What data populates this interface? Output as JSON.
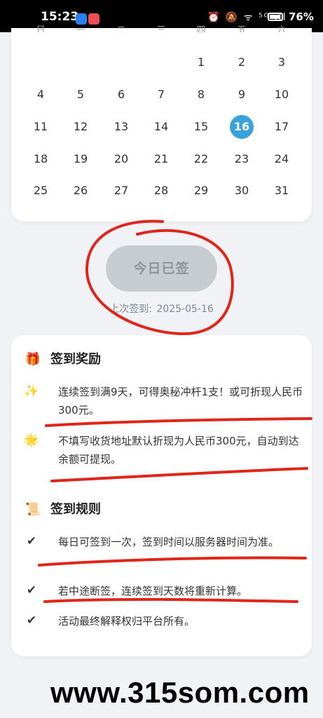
{
  "status_bar": {
    "time": "15:23",
    "icons": "⏰ 🔕 ᯤ ⁵ᴳ ıll",
    "battery": "76%"
  },
  "calendar": {
    "weekday_headers": [
      "日",
      "一",
      "二",
      "三",
      "四",
      "五",
      "六"
    ],
    "weeks": [
      [
        "",
        "",
        "",
        "",
        "1",
        "2",
        "3"
      ],
      [
        "4",
        "5",
        "6",
        "7",
        "8",
        "9",
        "10"
      ],
      [
        "11",
        "12",
        "13",
        "14",
        "15",
        "16",
        "17"
      ],
      [
        "18",
        "19",
        "20",
        "21",
        "22",
        "23",
        "24"
      ],
      [
        "25",
        "26",
        "27",
        "28",
        "29",
        "30",
        "31"
      ]
    ],
    "today": "16",
    "today_color": "#3aa2d8"
  },
  "sign": {
    "button_label": "今日已签",
    "last_sign_label": "上次签到:",
    "last_sign_date": "2025-05-16"
  },
  "rewards": {
    "title": "签到奖励",
    "title_icon": "gift-icon",
    "items": [
      {
        "icon": "sparkles-icon",
        "text": "连续签到满9天，可得奥秘冲杆1支！或可折现人民币300元。"
      },
      {
        "icon": "star-icon",
        "text": "不填写收货地址默认折现为人民币300元，自动到达余额可提现。"
      }
    ]
  },
  "rules": {
    "title": "签到规则",
    "title_icon": "scroll-icon",
    "items": [
      {
        "icon": "check-icon",
        "text": "每日可签到一次，签到时间以服务器时间为准。"
      },
      {
        "icon": "check-icon",
        "text": "若中途断签，连续签到天数将重新计算。"
      },
      {
        "icon": "check-icon",
        "text": "活动最终解释权归平台所有。"
      }
    ]
  },
  "watermark": "www.315som.com",
  "annotation_color": "#e0261b"
}
